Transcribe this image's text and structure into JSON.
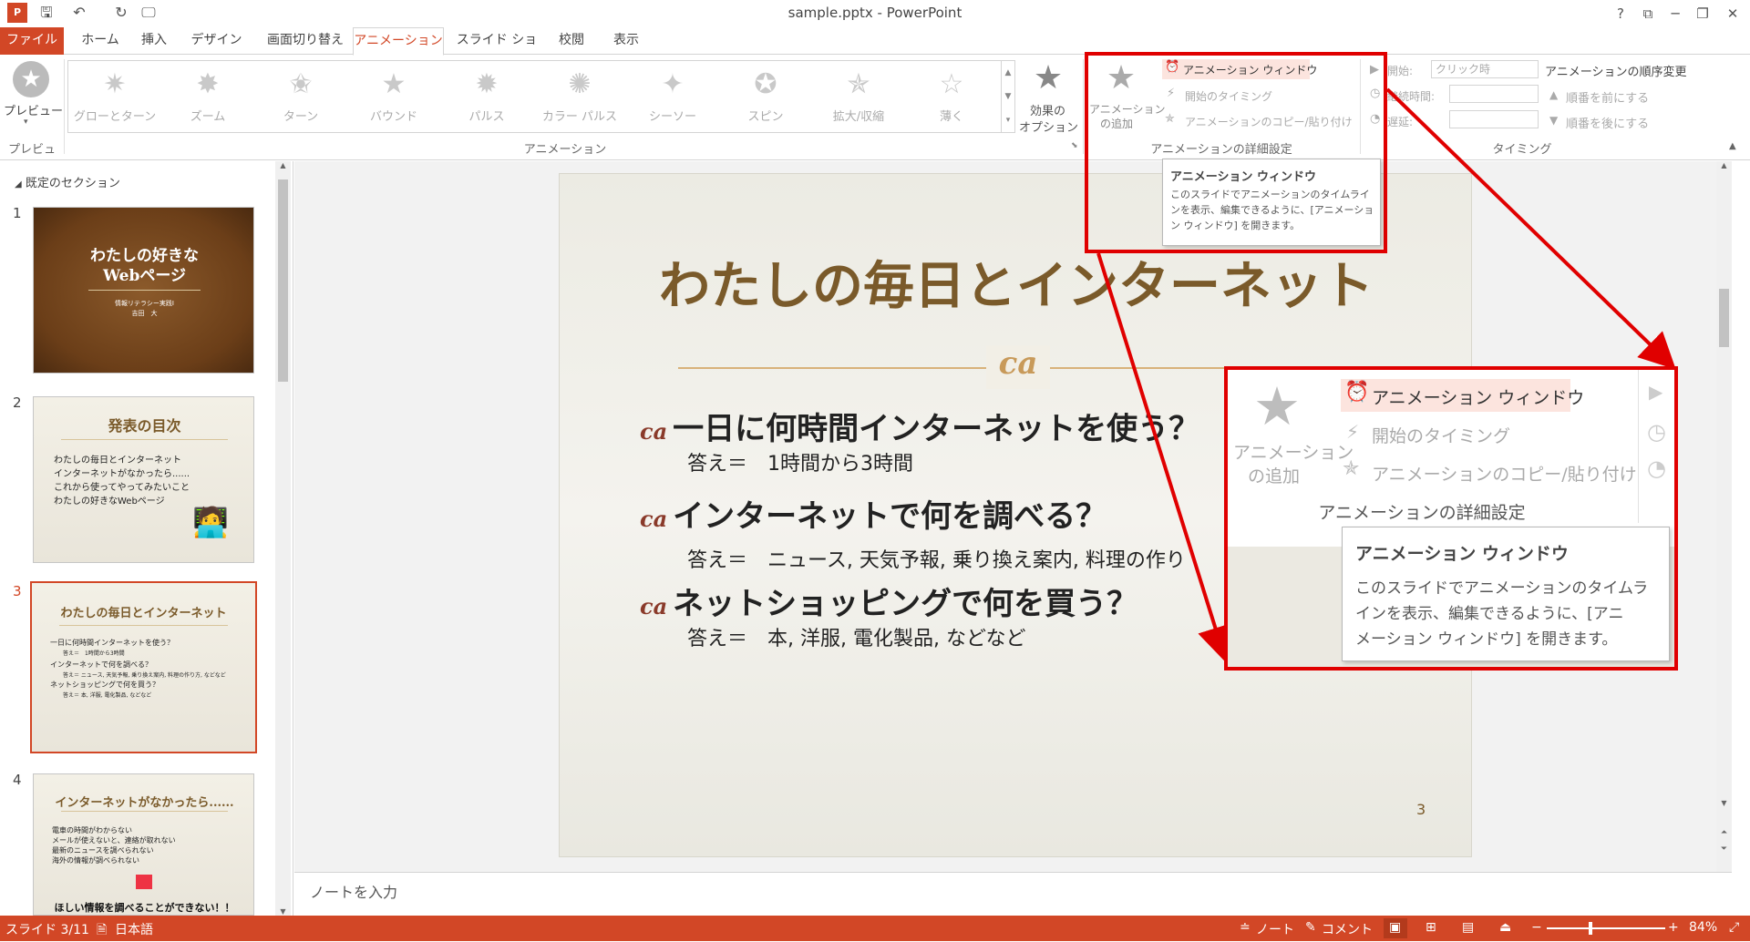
{
  "window": {
    "title": "sample.pptx - PowerPoint",
    "controls": [
      "?",
      "⧉",
      "─",
      "❐",
      "✕"
    ]
  },
  "tabs": [
    "ファイル",
    "ホーム",
    "挿入",
    "デザイン",
    "画面切り替え",
    "アニメーション",
    "スライド ショー",
    "校閲",
    "表示"
  ],
  "active_tab": "アニメーション",
  "ribbon": {
    "preview_label": "プレビュー",
    "preview_group": "プレビュー",
    "gallery_items": [
      "グローとターン",
      "ズーム",
      "ターン",
      "バウンド",
      "パルス",
      "カラー パルス",
      "シーソー",
      "スピン",
      "拡大/収縮",
      "薄く"
    ],
    "effect_options_1": "効果の",
    "effect_options_2": "オプション",
    "animation_group": "アニメーション",
    "add_animation_1": "アニメーション",
    "add_animation_2": "の追加",
    "animation_window": "アニメーション ウィンドウ",
    "start_timing": "開始のタイミング",
    "copy_paste": "アニメーションのコピー/貼り付け",
    "advanced_group": "アニメーションの詳細設定",
    "start_label": "開始:",
    "start_value": "クリック時",
    "duration_label": "継続時間:",
    "delay_label": "遅延:",
    "reorder_title": "アニメーションの順序変更",
    "move_earlier": "順番を前にする",
    "move_later": "順番を後にする",
    "timing_group": "タイミング"
  },
  "left_pane": {
    "section": "既定のセクション",
    "thumbs": [
      {
        "num": "1",
        "title": "わたしの好きな",
        "title2": "Webページ",
        "sub1": "情報リテラシー実践Ⅰ",
        "sub2": "吉田　大"
      },
      {
        "num": "2",
        "title": "発表の目次",
        "items": [
          "わたしの毎日とインターネット",
          "インターネットがなかったら......",
          "これから使ってやってみたいこと",
          "わたしの好きなWebページ"
        ]
      },
      {
        "num": "3",
        "title": "わたしの毎日とインターネット",
        "items": [
          "一日に何時間インターネットを使う？",
          "答え＝　1時間から3時間",
          "インターネットで何を調べる？",
          "答え＝ ニュース, 天気予報, 乗り換え案内, 料理の作り方, などなど",
          "ネットショッピングで何を買う？",
          "答え＝ 本, 洋服, 電化製品, などなど"
        ]
      },
      {
        "num": "4",
        "title": "インターネットがなかったら......",
        "items": [
          "電車の時間がわからない",
          "メールが使えないと、連絡が取れない",
          "最新のニュースを調べられない",
          "海外の情報が調べられない"
        ],
        "footer": "ほしい情報を調べることができない！！"
      }
    ]
  },
  "slide": {
    "title": "わたしの毎日とインターネット",
    "q1": "一日に何時間インターネットを使う？",
    "a1": "答え＝　1時間から3時間",
    "q2": "インターネットで何を調べる？",
    "a2": "答え＝　ニュース, 天気予報, 乗り換え案内, 料理の作り",
    "q3": "ネットショッピングで何を買う？",
    "a3": "答え＝　本, 洋服, 電化製品, などなど",
    "page_number": "3",
    "bullet_glyph": "ca"
  },
  "notes_placeholder": "ノートを入力",
  "tooltip": {
    "title": "アニメーション ウィンドウ",
    "body": "このスライドでアニメーションのタイムラインを表示、編集できるように、[アニメーション ウィンドウ] を開きます。"
  },
  "zoom_callout": {
    "animation_window": "アニメーション ウィンドウ",
    "start_timing": "開始のタイミング",
    "copy_paste": "アニメーションのコピー/貼り付け",
    "add_1": "アニメーション",
    "add_2": "の追加",
    "group": "アニメーションの詳細設定",
    "tt_title": "アニメーション ウィンドウ",
    "tt_body_1": "このスライドでアニメーションのタイムラ",
    "tt_body_2": "インを表示、編集できるように、[アニ",
    "tt_body_3": "メーション ウィンドウ] を開きます。"
  },
  "status": {
    "slide": "スライド 3/11",
    "language": "日本語",
    "notes": "ノート",
    "comments": "コメント",
    "zoom": "84%"
  },
  "colors": {
    "accent": "#d24726",
    "callout": "#e00000",
    "title_brown": "#7a5a2a"
  }
}
